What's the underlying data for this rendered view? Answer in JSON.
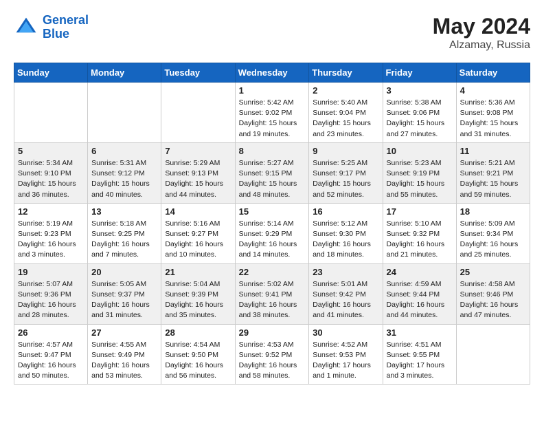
{
  "header": {
    "logo_line1": "General",
    "logo_line2": "Blue",
    "month_year": "May 2024",
    "location": "Alzamay, Russia"
  },
  "weekdays": [
    "Sunday",
    "Monday",
    "Tuesday",
    "Wednesday",
    "Thursday",
    "Friday",
    "Saturday"
  ],
  "weeks": [
    [
      {
        "day": "",
        "info": ""
      },
      {
        "day": "",
        "info": ""
      },
      {
        "day": "",
        "info": ""
      },
      {
        "day": "1",
        "info": "Sunrise: 5:42 AM\nSunset: 9:02 PM\nDaylight: 15 hours\nand 19 minutes."
      },
      {
        "day": "2",
        "info": "Sunrise: 5:40 AM\nSunset: 9:04 PM\nDaylight: 15 hours\nand 23 minutes."
      },
      {
        "day": "3",
        "info": "Sunrise: 5:38 AM\nSunset: 9:06 PM\nDaylight: 15 hours\nand 27 minutes."
      },
      {
        "day": "4",
        "info": "Sunrise: 5:36 AM\nSunset: 9:08 PM\nDaylight: 15 hours\nand 31 minutes."
      }
    ],
    [
      {
        "day": "5",
        "info": "Sunrise: 5:34 AM\nSunset: 9:10 PM\nDaylight: 15 hours\nand 36 minutes."
      },
      {
        "day": "6",
        "info": "Sunrise: 5:31 AM\nSunset: 9:12 PM\nDaylight: 15 hours\nand 40 minutes."
      },
      {
        "day": "7",
        "info": "Sunrise: 5:29 AM\nSunset: 9:13 PM\nDaylight: 15 hours\nand 44 minutes."
      },
      {
        "day": "8",
        "info": "Sunrise: 5:27 AM\nSunset: 9:15 PM\nDaylight: 15 hours\nand 48 minutes."
      },
      {
        "day": "9",
        "info": "Sunrise: 5:25 AM\nSunset: 9:17 PM\nDaylight: 15 hours\nand 52 minutes."
      },
      {
        "day": "10",
        "info": "Sunrise: 5:23 AM\nSunset: 9:19 PM\nDaylight: 15 hours\nand 55 minutes."
      },
      {
        "day": "11",
        "info": "Sunrise: 5:21 AM\nSunset: 9:21 PM\nDaylight: 15 hours\nand 59 minutes."
      }
    ],
    [
      {
        "day": "12",
        "info": "Sunrise: 5:19 AM\nSunset: 9:23 PM\nDaylight: 16 hours\nand 3 minutes."
      },
      {
        "day": "13",
        "info": "Sunrise: 5:18 AM\nSunset: 9:25 PM\nDaylight: 16 hours\nand 7 minutes."
      },
      {
        "day": "14",
        "info": "Sunrise: 5:16 AM\nSunset: 9:27 PM\nDaylight: 16 hours\nand 10 minutes."
      },
      {
        "day": "15",
        "info": "Sunrise: 5:14 AM\nSunset: 9:29 PM\nDaylight: 16 hours\nand 14 minutes."
      },
      {
        "day": "16",
        "info": "Sunrise: 5:12 AM\nSunset: 9:30 PM\nDaylight: 16 hours\nand 18 minutes."
      },
      {
        "day": "17",
        "info": "Sunrise: 5:10 AM\nSunset: 9:32 PM\nDaylight: 16 hours\nand 21 minutes."
      },
      {
        "day": "18",
        "info": "Sunrise: 5:09 AM\nSunset: 9:34 PM\nDaylight: 16 hours\nand 25 minutes."
      }
    ],
    [
      {
        "day": "19",
        "info": "Sunrise: 5:07 AM\nSunset: 9:36 PM\nDaylight: 16 hours\nand 28 minutes."
      },
      {
        "day": "20",
        "info": "Sunrise: 5:05 AM\nSunset: 9:37 PM\nDaylight: 16 hours\nand 31 minutes."
      },
      {
        "day": "21",
        "info": "Sunrise: 5:04 AM\nSunset: 9:39 PM\nDaylight: 16 hours\nand 35 minutes."
      },
      {
        "day": "22",
        "info": "Sunrise: 5:02 AM\nSunset: 9:41 PM\nDaylight: 16 hours\nand 38 minutes."
      },
      {
        "day": "23",
        "info": "Sunrise: 5:01 AM\nSunset: 9:42 PM\nDaylight: 16 hours\nand 41 minutes."
      },
      {
        "day": "24",
        "info": "Sunrise: 4:59 AM\nSunset: 9:44 PM\nDaylight: 16 hours\nand 44 minutes."
      },
      {
        "day": "25",
        "info": "Sunrise: 4:58 AM\nSunset: 9:46 PM\nDaylight: 16 hours\nand 47 minutes."
      }
    ],
    [
      {
        "day": "26",
        "info": "Sunrise: 4:57 AM\nSunset: 9:47 PM\nDaylight: 16 hours\nand 50 minutes."
      },
      {
        "day": "27",
        "info": "Sunrise: 4:55 AM\nSunset: 9:49 PM\nDaylight: 16 hours\nand 53 minutes."
      },
      {
        "day": "28",
        "info": "Sunrise: 4:54 AM\nSunset: 9:50 PM\nDaylight: 16 hours\nand 56 minutes."
      },
      {
        "day": "29",
        "info": "Sunrise: 4:53 AM\nSunset: 9:52 PM\nDaylight: 16 hours\nand 58 minutes."
      },
      {
        "day": "30",
        "info": "Sunrise: 4:52 AM\nSunset: 9:53 PM\nDaylight: 17 hours\nand 1 minute."
      },
      {
        "day": "31",
        "info": "Sunrise: 4:51 AM\nSunset: 9:55 PM\nDaylight: 17 hours\nand 3 minutes."
      },
      {
        "day": "",
        "info": ""
      }
    ]
  ]
}
